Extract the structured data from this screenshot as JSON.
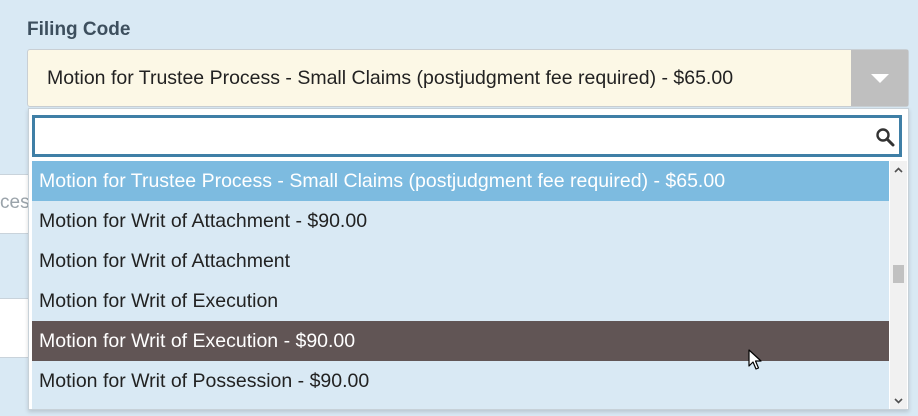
{
  "form": {
    "filing_code_label": "Filing Code",
    "background_partial_text": "ces"
  },
  "select": {
    "value": "Motion for Trustee Process - Small Claims (postjudgment fee required) - $65.00",
    "arrow_icon": "chevron-down-icon"
  },
  "dropdown": {
    "search": {
      "value": "",
      "placeholder": "",
      "icon": "search-icon"
    },
    "options": [
      {
        "label": "Motion for Trustee Process - Small Claims (postjudgment fee required) - $65.00",
        "state": "selected"
      },
      {
        "label": "Motion for Writ of Attachment - $90.00",
        "state": "normal"
      },
      {
        "label": "Motion for Writ of Attachment",
        "state": "normal"
      },
      {
        "label": "Motion for Writ of Execution",
        "state": "normal"
      },
      {
        "label": "Motion for Writ of Execution - $90.00",
        "state": "hovered"
      },
      {
        "label": "Motion for Writ of Possession - $90.00",
        "state": "normal"
      }
    ]
  },
  "colors": {
    "page_background": "#d9e9f4",
    "select_background": "#fcf8e6",
    "selected_option": "#7dbbe0",
    "hovered_option": "#615555",
    "search_border": "#3f7fa6",
    "arrow_button": "#bfbfbf"
  }
}
